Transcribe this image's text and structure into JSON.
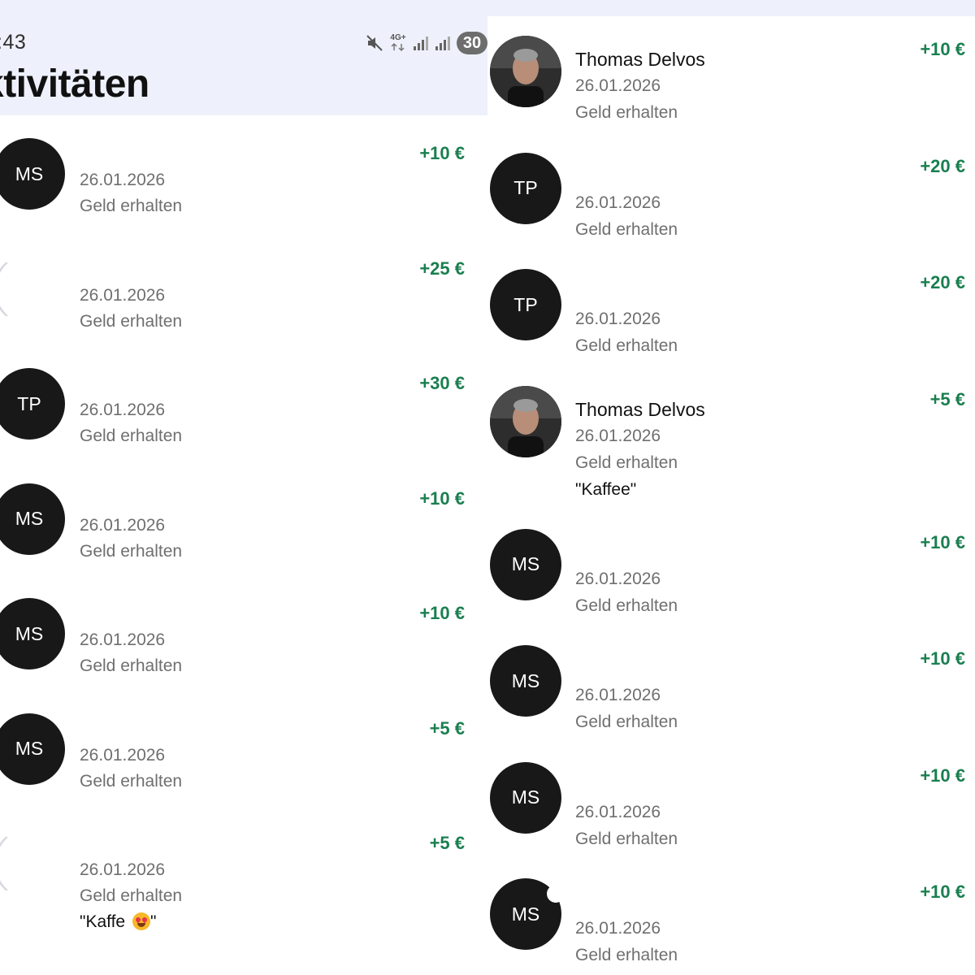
{
  "left": {
    "status_bar": {
      "time": ":43",
      "network_label": "4G+",
      "battery": "30",
      "icons": [
        "mute-icon",
        "network-4g-icon",
        "signal-icon",
        "signal-icon",
        "battery-icon"
      ]
    },
    "title": "ktivitäten",
    "rows": [
      {
        "initials": "MS",
        "name": "",
        "date": "26.01.2026",
        "status": "Geld erhalten",
        "memo": "",
        "amount": "+10 €"
      },
      {
        "initials": "",
        "name": "",
        "date": "26.01.2026",
        "status": "Geld erhalten",
        "memo": "",
        "amount": "+25 €"
      },
      {
        "initials": "TP",
        "name": "",
        "date": "26.01.2026",
        "status": "Geld erhalten",
        "memo": "",
        "amount": "+30 €"
      },
      {
        "initials": "MS",
        "name": "",
        "date": "26.01.2026",
        "status": "Geld erhalten",
        "memo": "",
        "amount": "+10 €"
      },
      {
        "initials": "MS",
        "name": "",
        "date": "26.01.2026",
        "status": "Geld erhalten",
        "memo": "",
        "amount": "+10 €"
      },
      {
        "initials": "MS",
        "name": "",
        "date": "26.01.2026",
        "status": "Geld erhalten",
        "memo": "",
        "amount": "+5 €"
      },
      {
        "initials": "",
        "name": "",
        "date": "26.01.2026",
        "status": "Geld erhalten",
        "memo": "\"Kaffe ",
        "memo_end": "\"",
        "memo_emoji": "heart-eyes-emoji",
        "amount": "+5 €"
      }
    ]
  },
  "right": {
    "rows": [
      {
        "initials": "",
        "avatar": "photo",
        "name": "Thomas Delvos",
        "date": "26.01.2026",
        "status": "Geld erhalten",
        "memo": "",
        "amount": "+10 €"
      },
      {
        "initials": "TP",
        "name": "",
        "date": "26.01.2026",
        "status": "Geld erhalten",
        "memo": "",
        "amount": "+20 €"
      },
      {
        "initials": "TP",
        "name": "",
        "date": "26.01.2026",
        "status": "Geld erhalten",
        "memo": "",
        "amount": "+20 €"
      },
      {
        "initials": "",
        "avatar": "photo",
        "name": "Thomas Delvos",
        "date": "26.01.2026",
        "status": "Geld erhalten",
        "memo": "\"Kaffee\"",
        "amount": "+5 €"
      },
      {
        "initials": "MS",
        "name": "",
        "date": "26.01.2026",
        "status": "Geld erhalten",
        "memo": "",
        "amount": "+10 €"
      },
      {
        "initials": "MS",
        "name": "",
        "date": "26.01.2026",
        "status": "Geld erhalten",
        "memo": "",
        "amount": "+10 €"
      },
      {
        "initials": "MS",
        "name": "",
        "date": "26.01.2026",
        "status": "Geld erhalten",
        "memo": "",
        "amount": "+10 €"
      },
      {
        "initials": "MS",
        "name": "",
        "date": "26.01.2026",
        "status": "Geld erhalten",
        "memo": "",
        "amount": "+10 €"
      }
    ]
  },
  "colors": {
    "amount": "#1a7f4f",
    "header_bg": "#eef1fb",
    "avatar_bg": "#181818",
    "secondary_text": "#6f6f6f"
  }
}
